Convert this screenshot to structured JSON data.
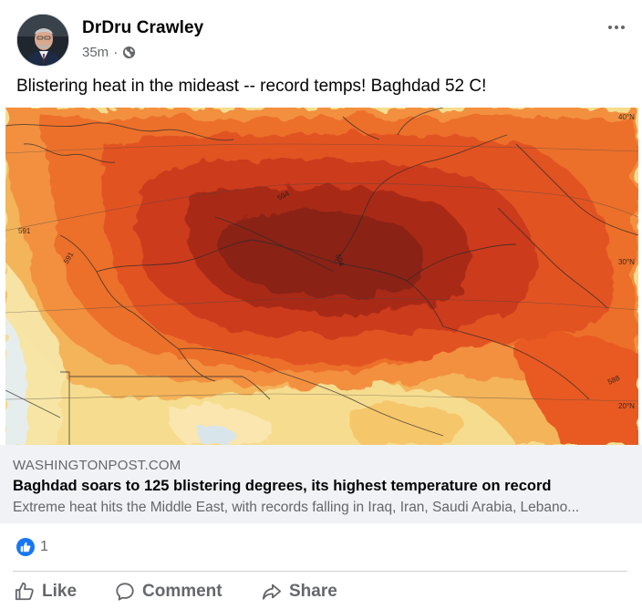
{
  "post": {
    "author": "DrDru Crawley",
    "time": "35m",
    "separator": "·",
    "privacy_icon": "globe-icon",
    "text": "Blistering heat in the mideast -- record temps!  Baghdad 52 C!"
  },
  "link_card": {
    "domain": "WASHINGTONPOST.COM",
    "title": "Baghdad soars to 125 blistering degrees, its highest temperature on record",
    "description": "Extreme heat hits the Middle East, with records falling in Iraq, Iran, Saudi Arabia, Lebano...",
    "map_labels": {
      "lat_40": "40°N",
      "lat_30": "30°N",
      "lat_20": "20°N",
      "contour_594_a": "594",
      "contour_594_b": "594",
      "contour_591_a": "591",
      "contour_591_b": "591",
      "contour_588": "588"
    }
  },
  "reactions": {
    "icon": "like-icon",
    "count": "1"
  },
  "actions": {
    "like": "Like",
    "comment": "Comment",
    "share": "Share"
  },
  "colors": {
    "facebook_blue": "#1877f2",
    "secondary_text": "#65676b",
    "card_background": "#f0f2f5",
    "heat_dark": "#7a1e12",
    "heat_mid": "#e0461b",
    "heat_light": "#f6d27a"
  }
}
